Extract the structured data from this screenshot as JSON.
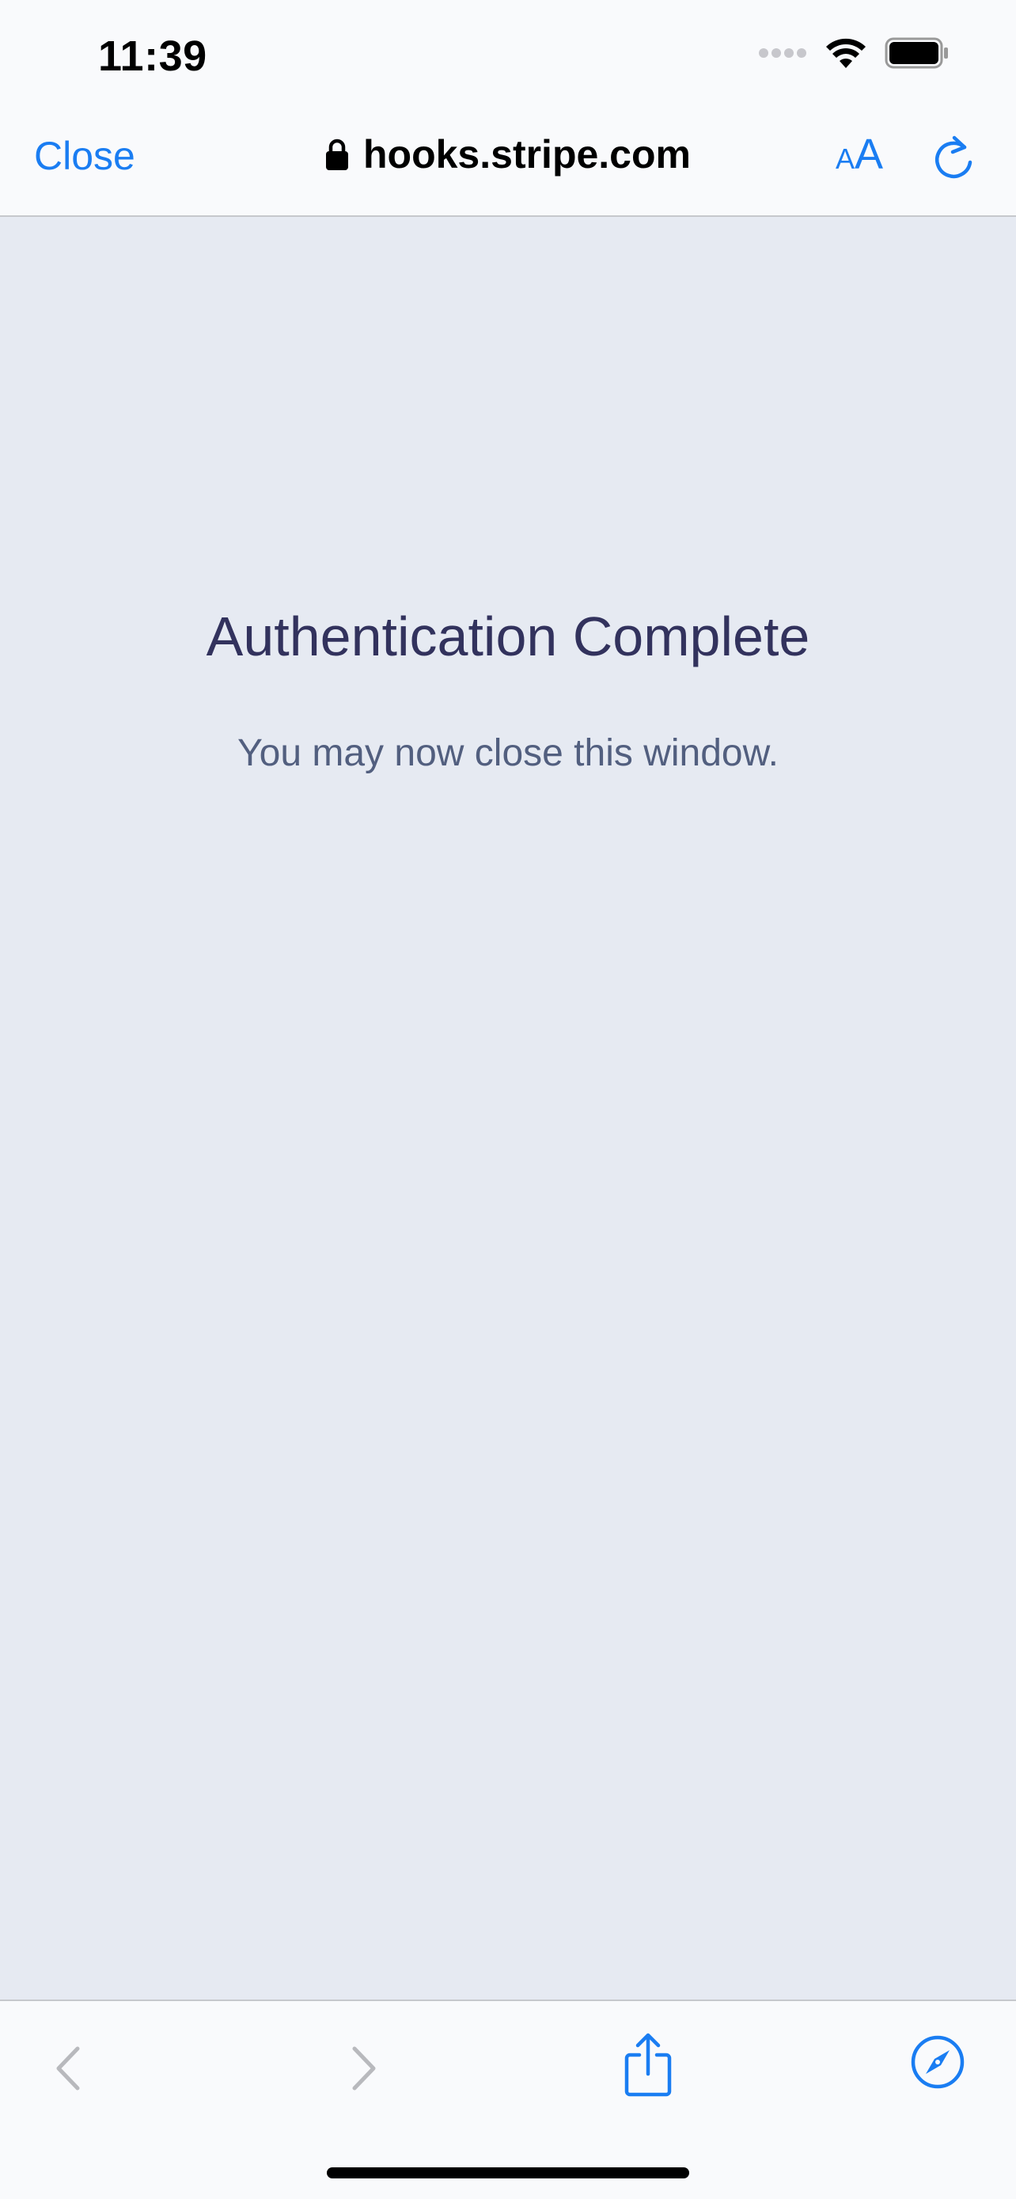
{
  "status_bar": {
    "time": "11:39"
  },
  "nav_bar": {
    "close_label": "Close",
    "url": "hooks.stripe.com",
    "text_size_label_small": "A",
    "text_size_label_big": "A"
  },
  "content": {
    "heading": "Authentication Complete",
    "message": "You may now close this window."
  },
  "colors": {
    "accent": "#1a7df2",
    "background": "#e6eaf2",
    "heading": "#32325d",
    "message": "#525f7f"
  }
}
